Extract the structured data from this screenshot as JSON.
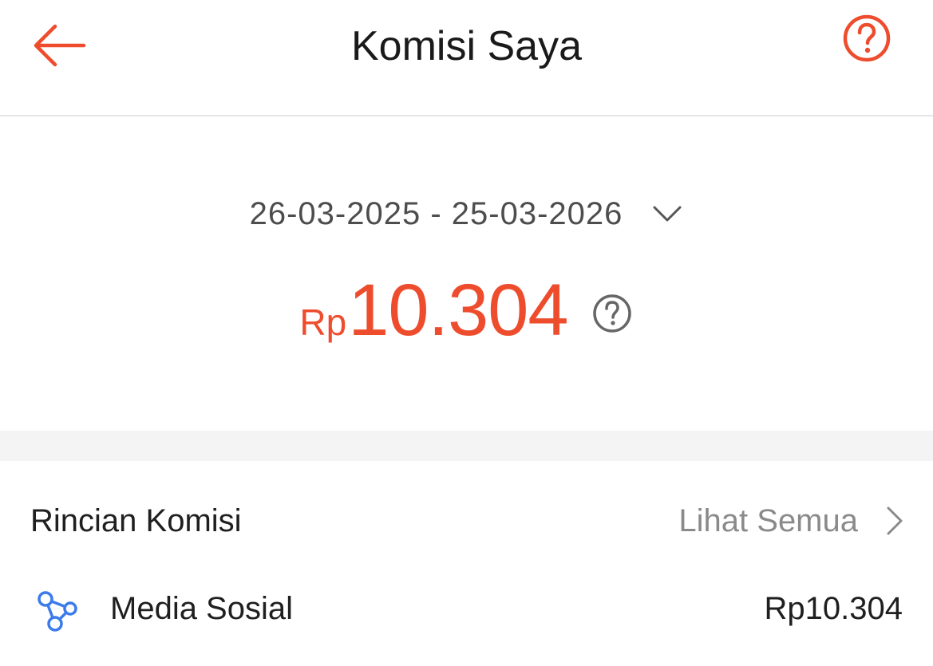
{
  "header": {
    "title": "Komisi Saya",
    "back_icon": "arrow-left-icon",
    "help_icon": "question-circle-icon",
    "accent_color": "#ee4d2d"
  },
  "summary": {
    "date_range": "26-03-2025 - 25-03-2026",
    "dropdown_icon": "chevron-down-icon",
    "currency": "Rp",
    "amount": "10.304",
    "amount_color": "#ee4d2d",
    "info_icon": "question-circle-icon"
  },
  "details": {
    "title": "Rincian Komisi",
    "see_all_label": "Lihat Semua",
    "see_all_icon": "chevron-right-icon",
    "items": [
      {
        "icon": "share-network-icon",
        "icon_color": "#3b7bea",
        "label": "Media Sosial",
        "value": "Rp10.304"
      }
    ]
  }
}
